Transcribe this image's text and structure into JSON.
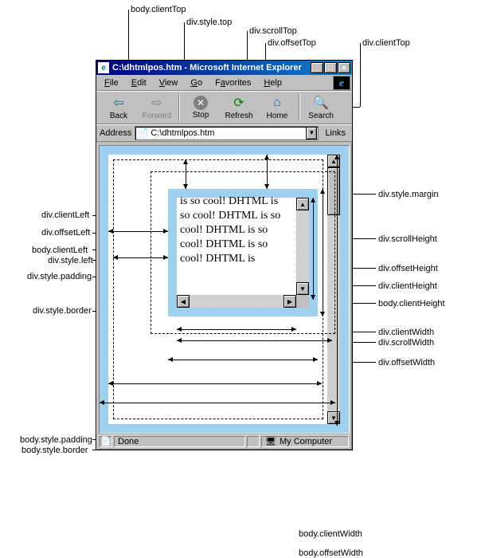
{
  "top_labels": {
    "body_clientTop": "body.clientTop",
    "div_style_top": "div.style.top",
    "div_scrollTop": "div.scrollTop",
    "div_offsetTop": "div.offsetTop",
    "div_clientTop": "div.clientTop"
  },
  "left_labels": {
    "div_clientLeft": "div.clientLeft",
    "div_offsetLeft": "div.offsetLeft",
    "body_clientLeft": "body.clientLeft",
    "div_style_left": "div.style.left",
    "div_style_padding": "div.style.padding",
    "div_style_border": "div.style.border",
    "body_style_padding": "body.style.padding",
    "body_style_border": "body.style.border"
  },
  "right_labels": {
    "div_style_margin": "div.style.margin",
    "div_scrollHeight": "div.scrollHeight",
    "div_offsetHeight": "div.offsetHeight",
    "div_clientHeight": "div.clientHeight",
    "body_clientHeight": "body.clientHeight",
    "div_clientWidth": "div.clientWidth",
    "div_scrollWidth": "div.scrollWidth",
    "div_offsetWidth": "div.offsetWidth"
  },
  "bottom_labels": {
    "body_clientWidth": "body.clientWidth",
    "body_offsetWidth": "body.offsetWidth"
  },
  "browser": {
    "title": "C:\\dhtmlpos.htm - Microsoft Internet Explorer",
    "menu": {
      "file": "File",
      "edit": "Edit",
      "view": "View",
      "go": "Go",
      "favorites": "Favorites",
      "help": "Help"
    },
    "toolbar": {
      "back": "Back",
      "forward": "Forward",
      "stop": "Stop",
      "refresh": "Refresh",
      "home": "Home",
      "search": "Search"
    },
    "address_label": "Address",
    "address_value": "C:\\dhtmlpos.htm",
    "links_label": "Links",
    "status_done": "Done",
    "status_zone": "My Computer"
  },
  "inner_text": "is so cool! DHTML is so cool! DHTML is so cool! DHTML is so cool! DHTML is so cool! DHTML is",
  "colors": {
    "chrome": "#c0c0c0",
    "titlebar": "#000080",
    "border_blue": "#9ed0f0"
  }
}
